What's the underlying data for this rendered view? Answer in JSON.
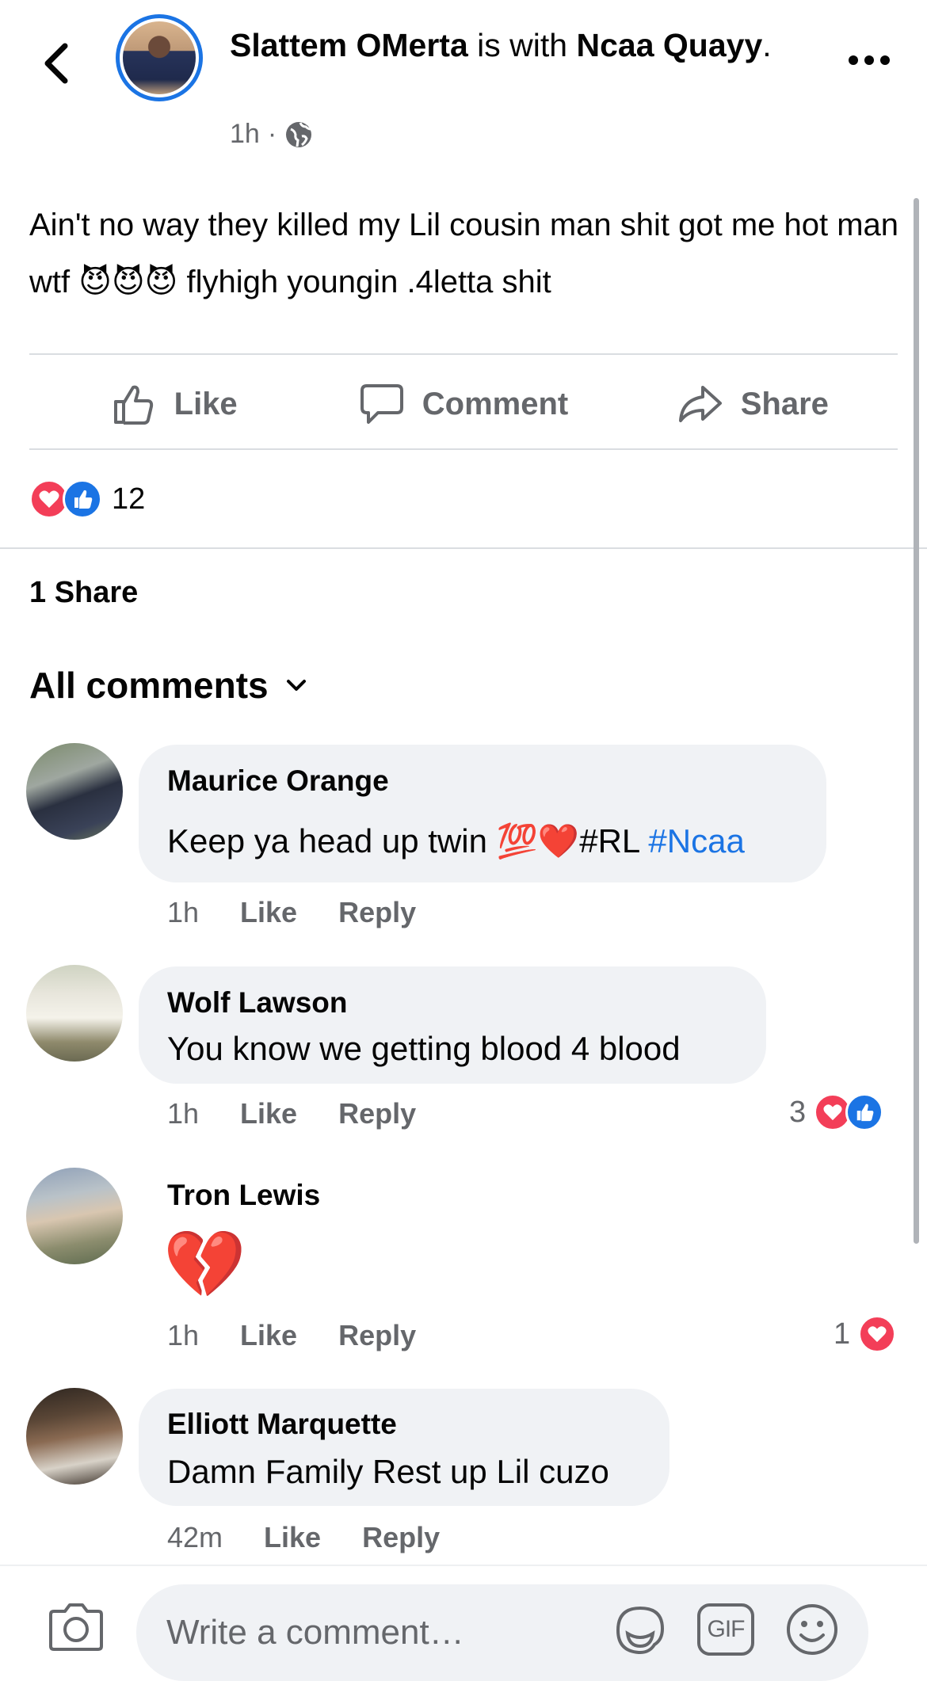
{
  "post": {
    "author": "Slattem OMerta",
    "with_text": "is with",
    "tagged": "Ncaa Quayy",
    "time": "1h",
    "body_part1": "Ain't no way they killed my Lil cousin man shit got me hot man wtf",
    "body_emoji": "😈😈😈",
    "body_part2": "flyhigh youngin .4letta shit"
  },
  "actions": {
    "like": "Like",
    "comment": "Comment",
    "share": "Share"
  },
  "reactions": {
    "count": "12"
  },
  "shares": "1 Share",
  "comments_header": "All comments",
  "comments": [
    {
      "name": "Maurice Orange",
      "text_a": "Keep ya head up twin",
      "text_emoji": "💯❤️",
      "text_b": "#RL",
      "text_link": "#Ncaa",
      "time": "1h",
      "like": "Like",
      "reply": "Reply"
    },
    {
      "name": "Wolf Lawson",
      "text": "You know we getting blood 4 blood",
      "time": "1h",
      "like": "Like",
      "reply": "Reply",
      "reaction_count": "3"
    },
    {
      "name": "Tron Lewis",
      "emoji": "💔",
      "time": "1h",
      "like": "Like",
      "reply": "Reply",
      "reaction_count": "1"
    },
    {
      "name": "Elliott Marquette",
      "text": "Damn Family Rest up Lil cuzo",
      "time": "42m",
      "like": "Like",
      "reply": "Reply"
    }
  ],
  "composer": {
    "placeholder": "Write a comment…",
    "gif_label": "GIF"
  },
  "colors": {
    "accent": "#1b74e4",
    "love": "#f33e58",
    "muted": "#65676b",
    "bubble": "#f0f2f5"
  }
}
